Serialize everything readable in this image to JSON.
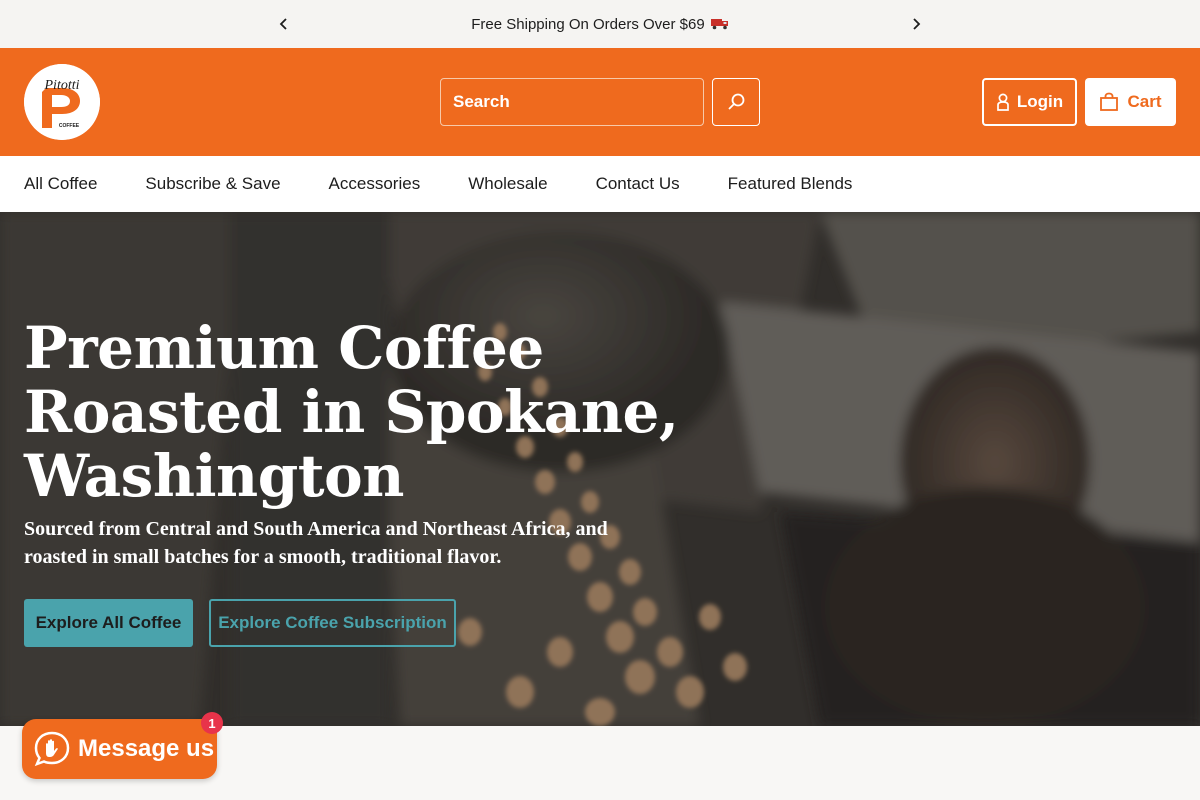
{
  "announcement": {
    "text": "Free Shipping On Orders Over $69",
    "icon": "delivery-truck-icon"
  },
  "header": {
    "logo_text": "Pitotti",
    "logo_sub": "COFFEE",
    "search_placeholder": "Search",
    "login_label": "Login",
    "cart_label": "Cart"
  },
  "nav": {
    "items": [
      "All Coffee",
      "Subscribe & Save",
      "Accessories",
      "Wholesale",
      "Contact Us",
      "Featured Blends"
    ]
  },
  "hero": {
    "title": "Premium Coffee Roasted in Spokane, Washington",
    "subtitle": "Sourced from Central and South America and Northeast Africa, and roasted in small batches for a smooth, traditional flavor.",
    "primary_cta": "Explore All Coffee",
    "secondary_cta": "Explore Coffee Subscription"
  },
  "chat": {
    "label": "Message us",
    "badge": "1"
  },
  "colors": {
    "brand_orange": "#ef6a1e",
    "accent_teal": "#4aa3ac",
    "badge_red": "#e8334a"
  }
}
